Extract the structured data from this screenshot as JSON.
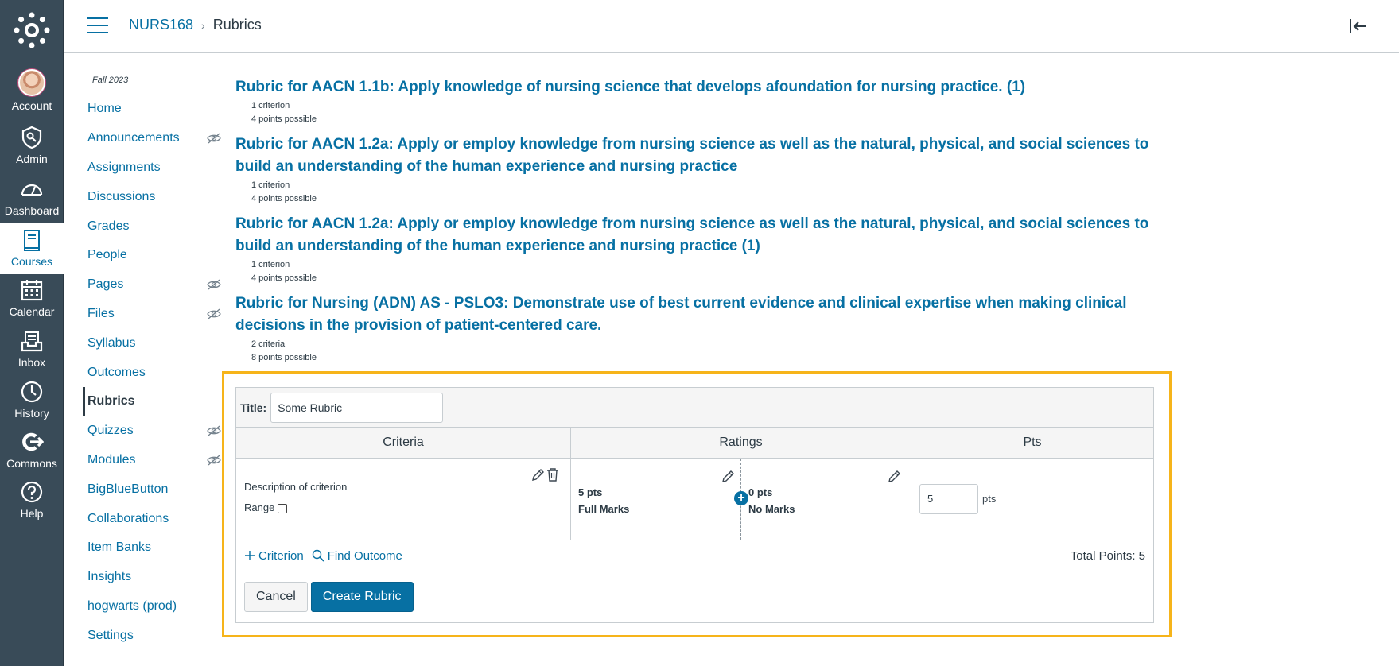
{
  "global_nav": {
    "items": [
      {
        "label": "Account",
        "icon": "account-avatar"
      },
      {
        "label": "Admin",
        "icon": "admin-icon"
      },
      {
        "label": "Dashboard",
        "icon": "dashboard-icon"
      },
      {
        "label": "Courses",
        "icon": "courses-icon"
      },
      {
        "label": "Calendar",
        "icon": "calendar-icon"
      },
      {
        "label": "Inbox",
        "icon": "inbox-icon"
      },
      {
        "label": "History",
        "icon": "history-icon"
      },
      {
        "label": "Commons",
        "icon": "commons-icon"
      },
      {
        "label": "Help",
        "icon": "help-icon"
      }
    ],
    "active": "Courses"
  },
  "header": {
    "course": "NURS168",
    "separator": "›",
    "page": "Rubrics"
  },
  "course_nav": {
    "term": "Fall 2023",
    "items": [
      {
        "label": "Home",
        "hidden": false
      },
      {
        "label": "Announcements",
        "hidden": true
      },
      {
        "label": "Assignments",
        "hidden": false
      },
      {
        "label": "Discussions",
        "hidden": false
      },
      {
        "label": "Grades",
        "hidden": false
      },
      {
        "label": "People",
        "hidden": false
      },
      {
        "label": "Pages",
        "hidden": true
      },
      {
        "label": "Files",
        "hidden": true
      },
      {
        "label": "Syllabus",
        "hidden": false
      },
      {
        "label": "Outcomes",
        "hidden": false
      },
      {
        "label": "Rubrics",
        "hidden": false
      },
      {
        "label": "Quizzes",
        "hidden": true
      },
      {
        "label": "Modules",
        "hidden": true
      },
      {
        "label": "BigBlueButton",
        "hidden": false
      },
      {
        "label": "Collaborations",
        "hidden": false
      },
      {
        "label": "Item Banks",
        "hidden": false
      },
      {
        "label": "Insights",
        "hidden": false
      },
      {
        "label": "hogwarts (prod)",
        "hidden": false
      },
      {
        "label": "Settings",
        "hidden": false
      }
    ],
    "active": "Rubrics"
  },
  "rubrics": [
    {
      "title": "Rubric for AACN 1.1b: Apply knowledge of nursing science that develops afoundation for nursing practice. (1)",
      "criteria": "1 criterion",
      "points": "4 points possible"
    },
    {
      "title": "Rubric for AACN 1.2a: Apply or employ knowledge from nursing science as well as the natural, physical, and social sciences to build an understanding of the human experience and nursing practice",
      "criteria": "1 criterion",
      "points": "4 points possible"
    },
    {
      "title": "Rubric for AACN 1.2a: Apply or employ knowledge from nursing science as well as the natural, physical, and social sciences to build an understanding of the human experience and nursing practice (1)",
      "criteria": "1 criterion",
      "points": "4 points possible"
    },
    {
      "title": "Rubric for Nursing (ADN) AS - PSLO3: Demonstrate use of best current evidence and clinical expertise when making clinical decisions in the provision of patient-centered care.",
      "criteria": "2 criteria",
      "points": "8 points possible"
    }
  ],
  "form": {
    "title_label": "Title:",
    "title_value": "Some Rubric",
    "columns": {
      "criteria": "Criteria",
      "ratings": "Ratings",
      "pts": "Pts"
    },
    "criterion": {
      "description": "Description of criterion",
      "range_label": "Range",
      "range_checked": false
    },
    "ratings": [
      {
        "points": "5 pts",
        "label": "Full Marks"
      },
      {
        "points": "0 pts",
        "label": "No Marks"
      }
    ],
    "add_rating_symbol": "+",
    "points_value": "5",
    "points_unit": "pts",
    "add_criterion": "Criterion",
    "find_outcome": "Find Outcome",
    "total_points": "Total Points: 5",
    "cancel": "Cancel",
    "create": "Create Rubric",
    "highlight_color": "#f6b41a"
  }
}
